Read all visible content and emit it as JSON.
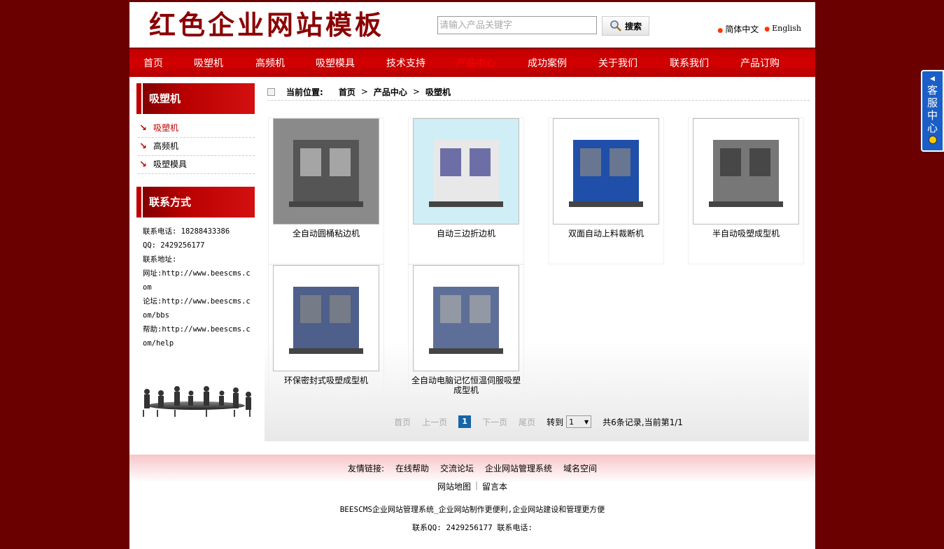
{
  "header": {
    "logo": "红色企业网站模板",
    "search_placeholder": "请输入产品关键字",
    "search_button": "搜索",
    "lang_cn": "简体中文",
    "lang_en": "English"
  },
  "nav": {
    "items": [
      "首页",
      "吸塑机",
      "高频机",
      "吸塑模具",
      "技术支持",
      "产品中心",
      "成功案例",
      "关于我们",
      "联系我们",
      "产品订购"
    ],
    "active_index": 5
  },
  "sidebar": {
    "category_title": "吸塑机",
    "items": [
      "吸塑机",
      "高频机",
      "吸塑模具"
    ],
    "contact_title": "联系方式",
    "contact_lines": [
      "联系电话: 18288433386",
      "QQ: 2429256177",
      "联系地址:",
      "网址:http://www.beescms.com",
      "论坛:http://www.beescms.com/bbs",
      "帮助:http://www.beescms.com/help"
    ]
  },
  "breadcrumb": {
    "label": "当前位置:",
    "items": [
      "首页",
      "产品中心",
      "吸塑机"
    ]
  },
  "products": [
    {
      "name": "全自动圆桶粘边机"
    },
    {
      "name": "自动三边折边机"
    },
    {
      "name": "双面自动上料裁断机"
    },
    {
      "name": "半自动吸塑成型机"
    },
    {
      "name": "环保密封式吸塑成型机"
    },
    {
      "name": "全自动电脑记忆恒温伺服吸塑成型机"
    }
  ],
  "pager": {
    "first": "首页",
    "prev": "上一页",
    "current": "1",
    "next": "下一页",
    "last": "尾页",
    "goto_label": "转到",
    "goto_value": "1",
    "summary": "共6条记录,当前第1/1"
  },
  "footer": {
    "links_label": "友情链接:",
    "links": [
      "在线帮助",
      "交流论坛",
      "企业网站管理系统",
      "域名空间"
    ],
    "sitemap": "网站地图",
    "guestbook": "留言本",
    "tagline": "BEESCMS企业网站管理系统_企业网站制作更便利,企业网站建设和管理更方便",
    "contact": "联系QQ: 2429256177 联系电话:"
  },
  "service_float": {
    "label": "客服中心"
  }
}
